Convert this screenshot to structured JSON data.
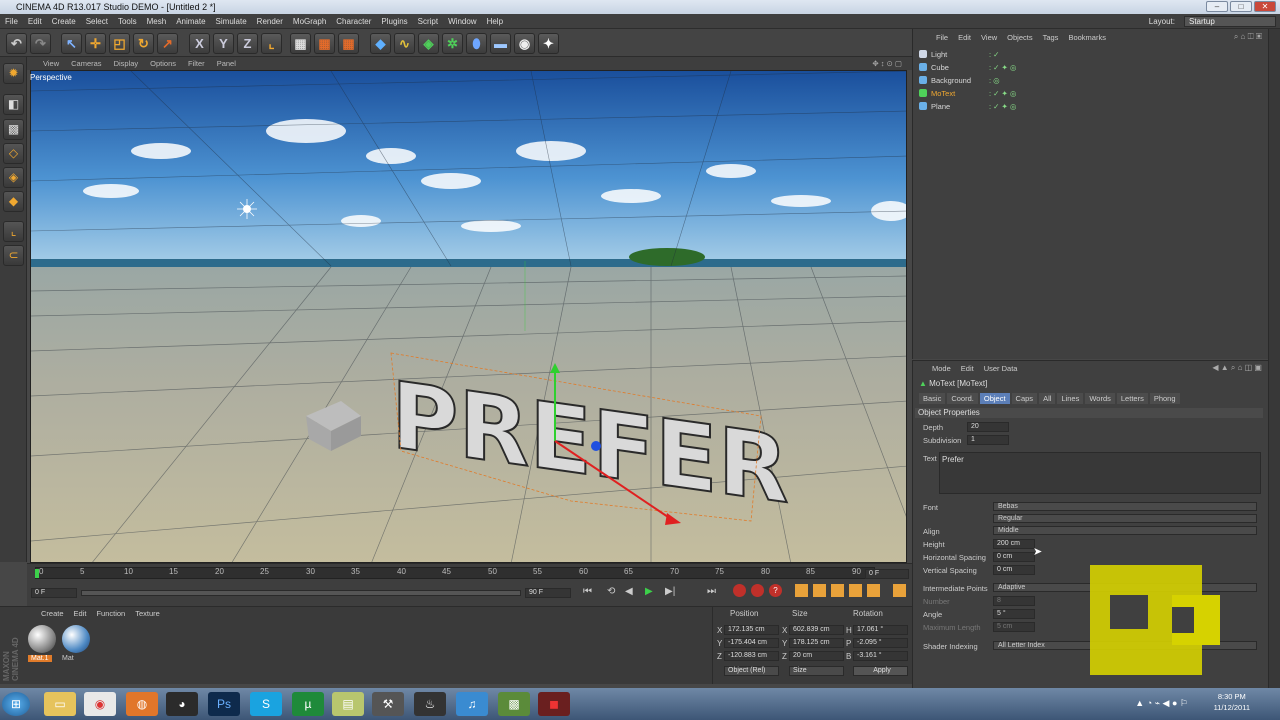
{
  "window": {
    "title": "CINEMA 4D R13.017 Studio DEMO - [Untitled 2 *]"
  },
  "menubar": {
    "items": [
      "File",
      "Edit",
      "Create",
      "Select",
      "Tools",
      "Mesh",
      "Animate",
      "Simulate",
      "Render",
      "MoGraph",
      "Character",
      "Plugins",
      "Script",
      "Window",
      "Help"
    ],
    "layout_label": "Layout:",
    "layout_value": "Startup"
  },
  "viewport": {
    "menu": [
      "View",
      "Cameras",
      "Display",
      "Options",
      "Filter",
      "Panel"
    ],
    "label": "Perspective",
    "text_object": "PREFER"
  },
  "timeline": {
    "ticks": [
      "0",
      "5",
      "10",
      "15",
      "20",
      "25",
      "30",
      "35",
      "40",
      "45",
      "50",
      "55",
      "60",
      "65",
      "70",
      "75",
      "80",
      "85",
      "90"
    ],
    "current_frame": "0 F",
    "start_frame": "0 F",
    "end_frame": "90 F"
  },
  "materials": {
    "menu": [
      "Create",
      "Edit",
      "Function",
      "Texture"
    ],
    "items": [
      "Mat.1",
      "Mat"
    ]
  },
  "coordinates": {
    "headers": [
      "Position",
      "Size",
      "Rotation"
    ],
    "rows": [
      {
        "axis": "X",
        "pos": "172.135 cm",
        "saxis": "X",
        "size": "602.839 cm",
        "raxis": "H",
        "rot": "17.061 °"
      },
      {
        "axis": "Y",
        "pos": "-175.404 cm",
        "saxis": "Y",
        "size": "178.125 cm",
        "raxis": "P",
        "rot": "-2.095 °"
      },
      {
        "axis": "Z",
        "pos": "-120.883 cm",
        "saxis": "Z",
        "size": "20 cm",
        "raxis": "B",
        "rot": "-3.161 °"
      }
    ],
    "mode": "Object (Rel)",
    "size_mode": "Size",
    "apply": "Apply"
  },
  "objects": {
    "menu": [
      "File",
      "Edit",
      "View",
      "Objects",
      "Tags",
      "Bookmarks"
    ],
    "items": [
      {
        "name": "Light",
        "color": "#cfd7e6"
      },
      {
        "name": "Cube",
        "color": "#6ab0e8"
      },
      {
        "name": "Background",
        "color": "#6ab0e8"
      },
      {
        "name": "MoText",
        "color": "#4fd15a",
        "highlight": true
      },
      {
        "name": "Plane",
        "color": "#6ab0e8"
      }
    ]
  },
  "attributes": {
    "menu": [
      "Mode",
      "Edit",
      "User Data"
    ],
    "object_title": "MoText [MoText]",
    "tabs": [
      "Basic",
      "Coord.",
      "Object",
      "Caps",
      "All",
      "Lines",
      "Words",
      "Letters",
      "Phong"
    ],
    "active_tab": "Object",
    "section": "Object Properties",
    "depth_label": "Depth",
    "depth": "20",
    "subdivision_label": "Subdivision",
    "subdivision": "1",
    "text_label": "Text",
    "text": "Prefer",
    "font_label": "Font",
    "font": "Bebas",
    "font_style": "Regular",
    "align_label": "Align",
    "align": "Middle",
    "height_label": "Height",
    "height": "200 cm",
    "hspacing_label": "Horizontal Spacing",
    "hspacing": "0 cm",
    "vspacing_label": "Vertical Spacing",
    "vspacing": "0 cm",
    "intermediate_label": "Intermediate Points",
    "intermediate": "Adaptive",
    "number_label": "Number",
    "number": "8",
    "angle_label": "Angle",
    "angle": "5 °",
    "maxlen_label": "Maximum Length",
    "maxlen": "5 cm",
    "shader_label": "Shader Indexing",
    "shader": "All Letter Index"
  },
  "taskbar": {
    "time": "8:30 PM",
    "date": "11/12/2011"
  },
  "sidebar_brand": "MAXON CINEMA 4D",
  "colors": {
    "accent_blue": "#5c7fb8",
    "orange": "#f0a830",
    "logo_yellow": "#d6d200"
  }
}
